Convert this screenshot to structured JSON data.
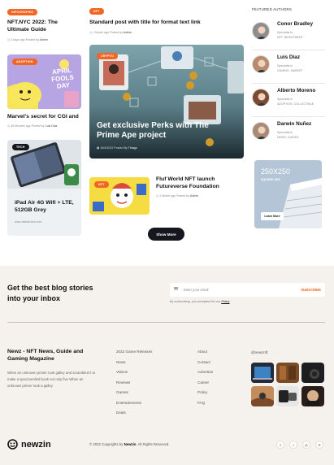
{
  "col1": {
    "post1": {
      "tag": "INFOGRAPHIC",
      "title": "NFT.NYC 2022: The Ultimate Guide",
      "time": "3 days ago",
      "posted_by_label": "Posted by",
      "author": "Admin"
    },
    "post2": {
      "tag": "ADOPTION",
      "image_text": "APRIL FOOLS DAY",
      "title": "Marvel's secret for CGI and",
      "time": "35 Minutes ago",
      "posted_by_label": "Posted by",
      "author": "Luis Diaz"
    },
    "post3": {
      "tag": "TECH",
      "title": "iPad Air 4G Wifi + LTE, 512GB Grey",
      "url": "www.fastsitchon.com"
    }
  },
  "col2": {
    "post1": {
      "tag": "NFT",
      "title": "Standard post with title for format text link",
      "time": "1 Month ago",
      "posted_by_label": "Posted by",
      "author": "Admin"
    },
    "featured": {
      "tag": "CRYPTO",
      "title": "Get exclusive Perks with The Prime Ape project",
      "date": "18/4/2022",
      "posted_by_label": "Posted By",
      "author": "Thiago"
    },
    "post3": {
      "tag": "NFT",
      "title": "Fluf World NFT launch Futureverse Foundation",
      "time": "1 Month ago",
      "posted_by_label": "Posted by",
      "author": "Admin"
    },
    "show_more": "Show More"
  },
  "authors": {
    "heading": "FEATURED AUTHORS",
    "items": [
      {
        "name": "Conor Bradley",
        "role_label": "Specialist in",
        "role": "NFT, INVESTMENT"
      },
      {
        "name": "Luis Diaz",
        "role_label": "Specialist in",
        "role": "GAMING, MARKET"
      },
      {
        "name": "Alberto Moreno",
        "role_label": "Specialist in",
        "role": "ADOPTION, COLLECTIBLE"
      },
      {
        "name": "Darwin Nuñez",
        "role_label": "Specialist in",
        "role": "NEWS, GUIDES"
      }
    ]
  },
  "ad": {
    "size": "250X250",
    "label": "SQUARE ADS",
    "button": "Learn More"
  },
  "newsletter": {
    "title": "Get the best blog stories into your inbox",
    "placeholder": "Enter your email",
    "button": "SUBSCRIBE",
    "note": "By subscribing, you accepted the our",
    "policy": "Policy"
  },
  "footer": {
    "about_title": "Newz - NFT News, Guide and Gaming Magazine",
    "about_text": "When an unknown printer took galley and scrambled it to make a specimenlied book not only five When an unknown primer took a galley",
    "col2_links": [
      "2022 Game Releases",
      "News",
      "Videos",
      "Reviews",
      "Games",
      "Entertainments",
      "Deals"
    ],
    "col3_links": [
      "About",
      "Contact",
      "Advertise",
      "Career",
      "Policy",
      "FAQ"
    ],
    "instagram_handle": "@newznft",
    "logo_text": "newzin",
    "copyright_prefix": "© 2022 Copyrights by",
    "copyright_brand": "Newzin",
    "copyright_suffix": ". All Rights Reserved.",
    "social_icons": [
      "twitter-icon",
      "facebook-icon",
      "instagram-icon",
      "pinterest-icon"
    ]
  },
  "colors": {
    "accent": "#f26522",
    "footer_bg": "#f5f2ee",
    "dark": "#16161f"
  }
}
